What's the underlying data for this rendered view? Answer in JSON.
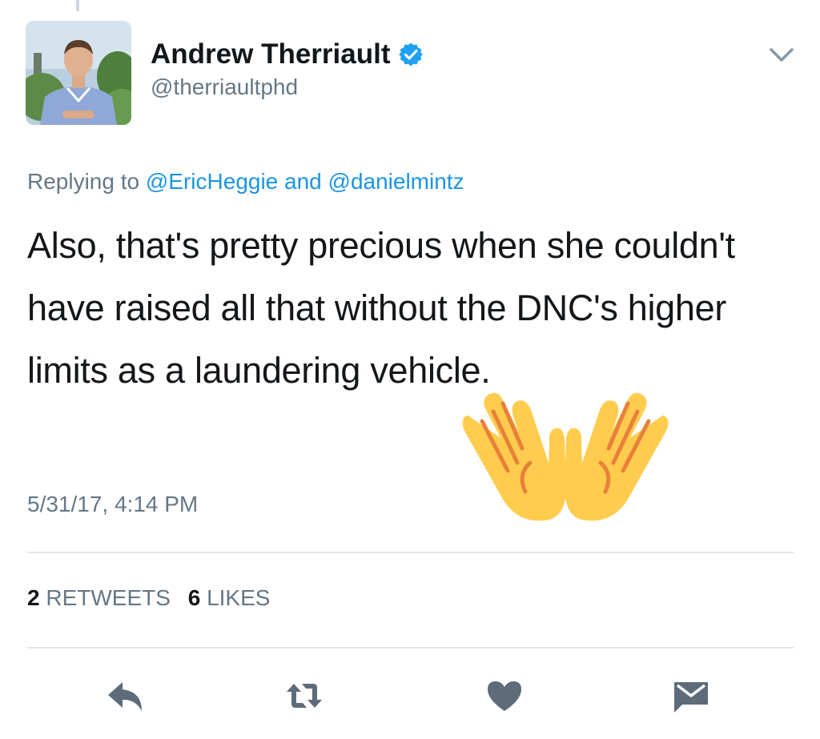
{
  "tweet": {
    "author": {
      "display_name": "Andrew Therriault",
      "handle": "@therriaultphd",
      "verified": true
    },
    "replying": {
      "prefix": "Replying to",
      "mention_1": "@EricHeggie",
      "joiner": "and",
      "mention_2": "@danielmintz"
    },
    "text": "Also, that's pretty precious when she couldn't have raised all that without the DNC's higher limits as a laundering vehicle.",
    "timestamp": "5/31/17, 4:14 PM",
    "stats": {
      "retweets_count": "2",
      "retweets_label": "RETWEETS",
      "likes_count": "6",
      "likes_label": "LIKES"
    }
  },
  "actions": [
    {
      "name": "reply",
      "icon": "reply-icon"
    },
    {
      "name": "retweet",
      "icon": "retweet-icon"
    },
    {
      "name": "like",
      "icon": "heart-icon"
    },
    {
      "name": "direct-message",
      "icon": "envelope-icon"
    }
  ],
  "overlay_emoji": {
    "icon": "raised-hands-emoji"
  },
  "colors": {
    "text_primary": "#14171a",
    "text_secondary": "#657786",
    "link": "#1b95e0",
    "verified": "#1da1f2",
    "divider": "#e1e8ed",
    "action_icon": "#5d6b7a",
    "emoji_fill": "#ffcc4d",
    "emoji_line": "#e8803a"
  }
}
